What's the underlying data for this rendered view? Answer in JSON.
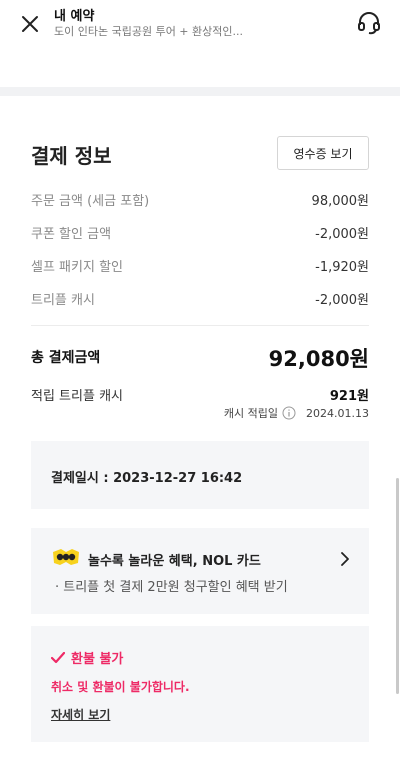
{
  "header": {
    "title": "내 예약",
    "subtitle": "도이 인타논 국립공원 투어 + 환상적인...",
    "close_icon": "close-icon",
    "support_icon": "headset-icon"
  },
  "payment": {
    "title": "결제 정보",
    "receipt_button": "영수증 보기",
    "rows": [
      {
        "label": "주문 금액 (세금 포함)",
        "value": "98,000원"
      },
      {
        "label": "쿠폰 할인 금액",
        "value": "-2,000원"
      },
      {
        "label": "셀프 패키지 할인",
        "value": "-1,920원"
      },
      {
        "label": "트리플 캐시",
        "value": "-2,000원"
      }
    ],
    "total_label": "총 결제금액",
    "total_value": "92,080원",
    "cash_label": "적립 트리플 캐시",
    "cash_value": "921원",
    "cash_date_label": "캐시 적립일",
    "cash_date": "2024.01.13"
  },
  "paydate": {
    "text": "결제일시 : 2023-12-27 16:42"
  },
  "nol": {
    "title": "놀수록 놀라운 혜택, NOL 카드",
    "subtitle": "· 트리플 첫 결제 2만원 청구할인 혜택 받기",
    "logo_text": "NOL"
  },
  "refund": {
    "title": "환불 불가",
    "description": "취소 및 환불이 불가합니다.",
    "link": "자세히 보기"
  },
  "colors": {
    "accent_pink": "#ee2a66",
    "nol_yellow": "#f7d21e"
  }
}
